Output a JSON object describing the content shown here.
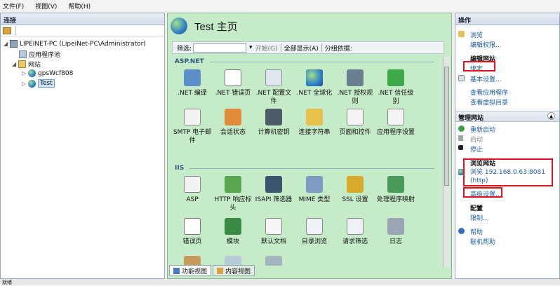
{
  "menu": {
    "file": "文件(F)",
    "view": "视图(V)",
    "help": "帮助(H)"
  },
  "left": {
    "title": "连接",
    "tree": {
      "server": "LIPEINET-PC (LipeiNet-PC\\Administrator)",
      "app_pools": "应用程序池",
      "sites": "网站",
      "site1": "gpsWcf808",
      "site2": "Test"
    }
  },
  "middle": {
    "title": "Test 主页",
    "filter_label": "筛选:",
    "start": "开始(G)",
    "show_all": "全部显示(A)",
    "group_by": "分组依据:",
    "sections": {
      "aspnet": "ASP.NET",
      "iis": "IIS"
    },
    "features_row1": [
      ".NET 编译",
      ".NET 错误页",
      ".NET 配置文件",
      ".NET 全球化",
      ".NET 授权规则",
      ".NET 信任级别"
    ],
    "features_row2": [
      "SMTP 电子邮件",
      "会话状态",
      "计算机密钥",
      "连接字符串",
      "页面和控件",
      "应用程序设置"
    ],
    "features_row3": [
      "ASP",
      "HTTP 响应标头",
      "ISAPI 筛选器",
      "MIME 类型",
      "SSL 设置",
      "处理程序映射"
    ],
    "features_row4": [
      "错误页",
      "模块",
      "默认文档",
      "目录浏览",
      "请求筛选",
      "日志"
    ],
    "tabs": {
      "features": "功能视图",
      "content": "内容视图"
    }
  },
  "right": {
    "title": "操作",
    "browse": "浏览",
    "edit_perms": "编辑权限...",
    "edit_site": "编辑网站",
    "bindings": "绑定...",
    "basic_settings": "基本设置...",
    "view_apps": "查看应用程序",
    "view_vdirs": "查看虚拟目录",
    "manage_site": "管理网站",
    "restart": "重新启动",
    "start": "启动",
    "stop": "停止",
    "browse_site": "浏览网站",
    "browse_url": "浏览 192.168.0.63:8081 (http)",
    "advanced": "高级设置...",
    "config": "配置",
    "limits": "限制...",
    "help": "帮助",
    "online_help": "联机帮助"
  },
  "status": {
    "text": "就绪"
  },
  "colors": {
    "highlight": "#e0141e",
    "link": "#1e5ea8",
    "feature_bg": "#c6ebc8"
  }
}
